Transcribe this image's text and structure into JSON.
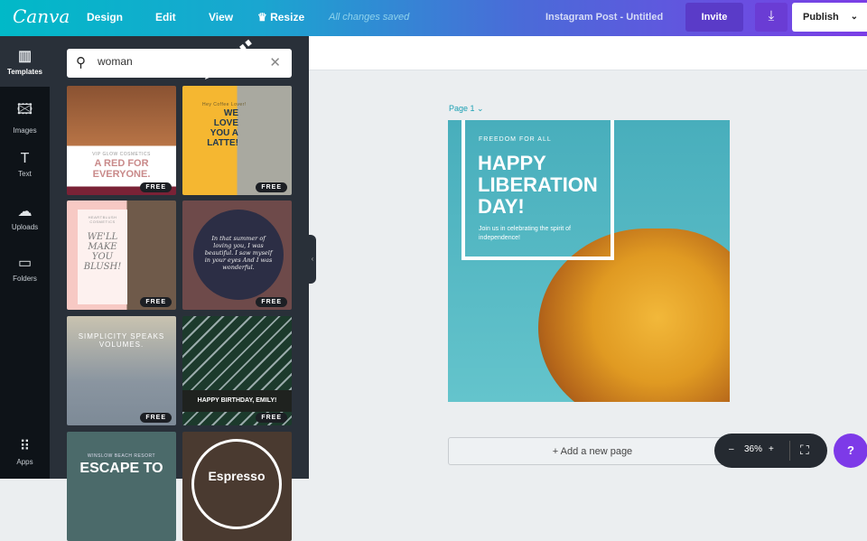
{
  "header": {
    "logo": "Canva",
    "menu": [
      "Design",
      "Edit",
      "View",
      "Resize"
    ],
    "status": "All changes saved",
    "doc_title": "Instagram Post - Untitled",
    "invite": "Invite",
    "publish": "Publish"
  },
  "sidebar": {
    "items": [
      {
        "label": "Templates",
        "icon": "▥"
      },
      {
        "label": "Images",
        "icon": "🖾"
      },
      {
        "label": "Text",
        "icon": "T"
      },
      {
        "label": "Uploads",
        "icon": "☁"
      },
      {
        "label": "Folders",
        "icon": "▭"
      },
      {
        "label": "Apps",
        "icon": "⠿"
      }
    ]
  },
  "search": {
    "value": "woman"
  },
  "templates": [
    {
      "title": "A RED FOR EVERYONE.",
      "sub": "VIP GLOW COSMETICS",
      "badge": "FREE"
    },
    {
      "title": "WE LOVE YOU A LATTE!",
      "sub": "Hey Coffee Lover!",
      "badge": "FREE"
    },
    {
      "title": "WE'LL MAKE YOU BLUSH!",
      "sub": "HEARTBLUSH COSMETICS",
      "badge": "FREE"
    },
    {
      "title": "In that summer of loving you, I was beautiful. I saw myself in your eyes And I was wonderful.",
      "sub": "",
      "badge": "FREE"
    },
    {
      "title": "SIMPLICITY SPEAKS VOLUMES.",
      "sub": "",
      "badge": "FREE"
    },
    {
      "title": "HAPPY BIRTHDAY, EMILY!",
      "sub": "",
      "badge": "FREE"
    },
    {
      "title": "ESCAPE TO",
      "sub": "WINSLOW BEACH RESORT",
      "badge": ""
    },
    {
      "title": "Espresso",
      "sub": "",
      "badge": ""
    }
  ],
  "canvas": {
    "page_label": "Page 1",
    "kicker": "FREEDOM FOR ALL",
    "headline": "HAPPY LIBERATION DAY!",
    "body": "Join us in celebrating the spirit of independence!",
    "add_page": "+ Add a new page",
    "zoom": "36%",
    "help": "?"
  }
}
